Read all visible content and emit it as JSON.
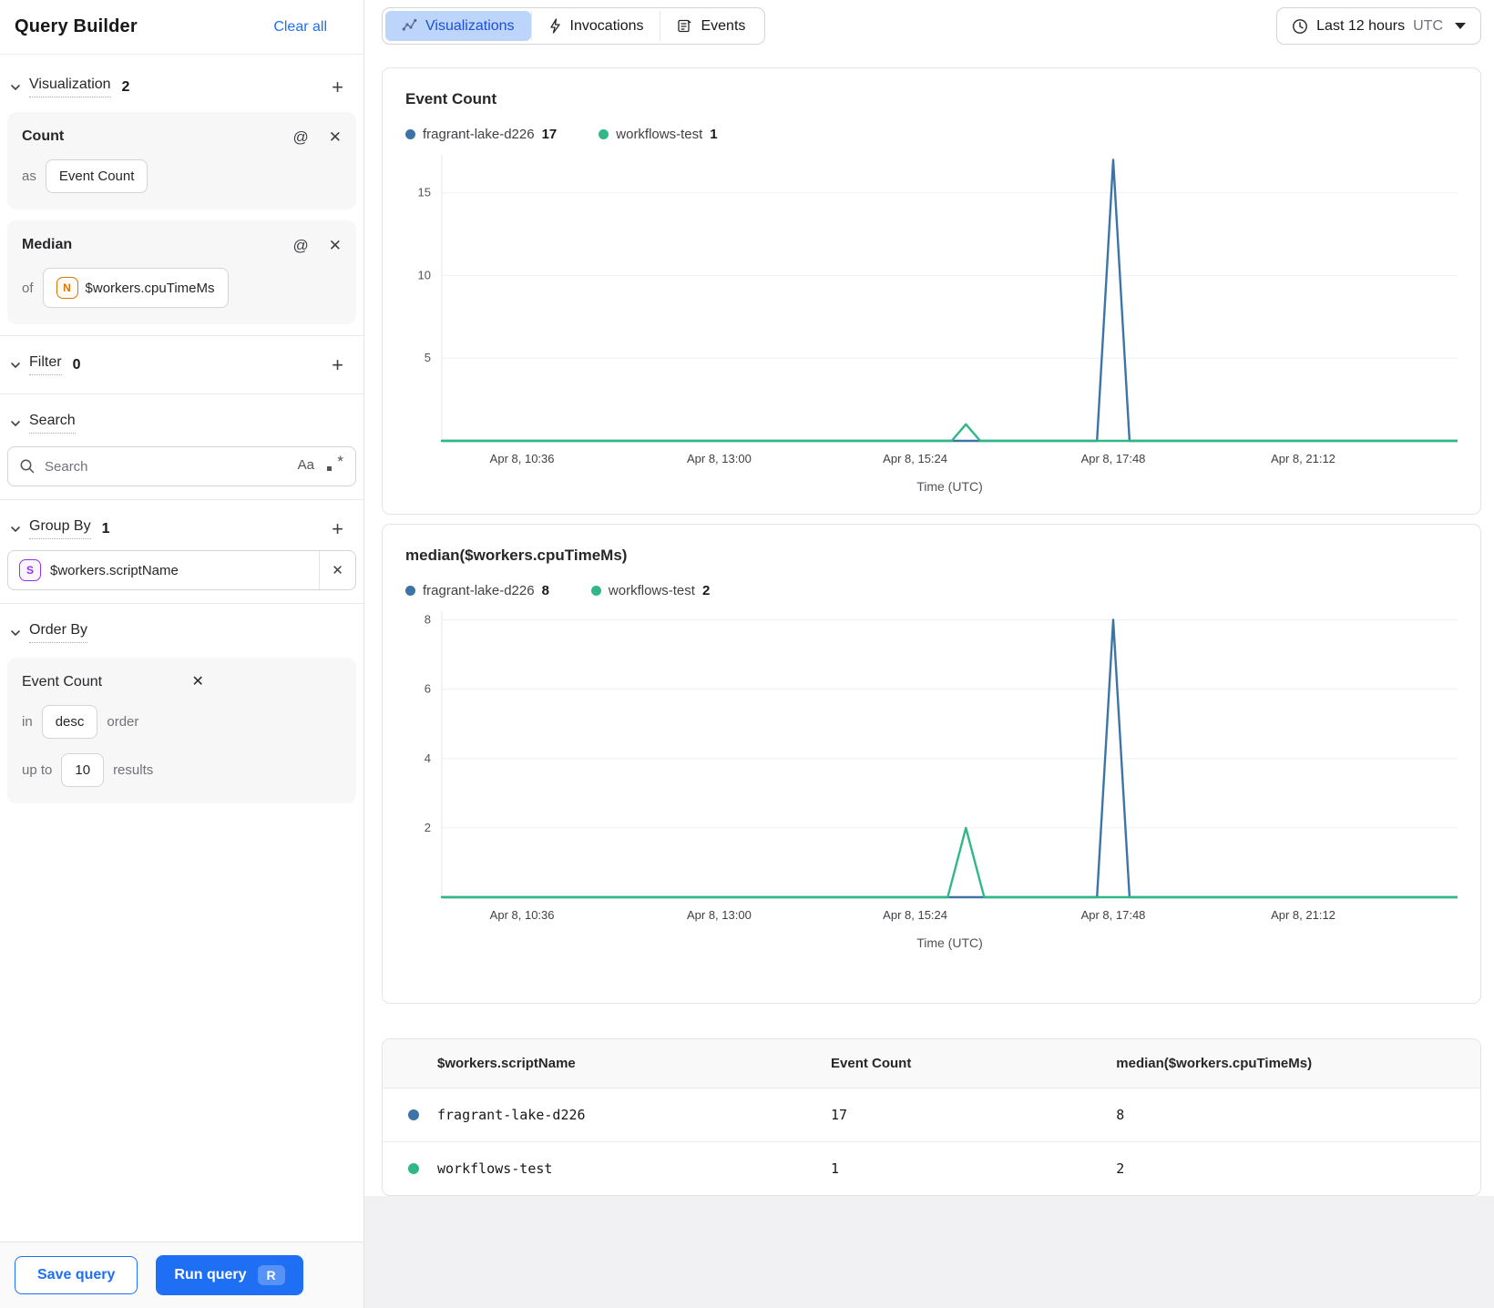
{
  "colors": {
    "accent_blue": "#1f6ff5",
    "active_tab_bg": "#bdd4fb",
    "active_tab_text": "#1d4ed8",
    "series_blue": "#3d74a8",
    "series_green": "#2fb885"
  },
  "sidebar": {
    "title": "Query Builder",
    "clear_all": "Clear all",
    "visualization": {
      "label": "Visualization",
      "count": "2",
      "cards": [
        {
          "title": "Count",
          "prefix": "as",
          "value": "Event Count"
        },
        {
          "title": "Median",
          "prefix": "of",
          "badge": "N",
          "value": "$workers.cpuTimeMs"
        }
      ]
    },
    "filter": {
      "label": "Filter",
      "count": "0"
    },
    "search": {
      "label": "Search",
      "placeholder": "Search",
      "match_case": "Aa"
    },
    "group_by": {
      "label": "Group By",
      "count": "1",
      "items": [
        {
          "badge": "S",
          "value": "$workers.scriptName"
        }
      ]
    },
    "order_by": {
      "label": "Order By",
      "field": "Event Count",
      "in_label": "in",
      "direction": "desc",
      "order_label": "order",
      "up_to_label": "up to",
      "limit": "10",
      "results_label": "results"
    },
    "footer": {
      "save": "Save query",
      "run": "Run query",
      "shortcut": "R"
    }
  },
  "topbar": {
    "tabs": [
      {
        "label": "Visualizations",
        "icon": "trend-icon",
        "active": true
      },
      {
        "label": "Invocations",
        "icon": "lightning-icon",
        "active": false
      },
      {
        "label": "Events",
        "icon": "events-icon",
        "active": false
      }
    ],
    "time_range": {
      "label": "Last 12 hours",
      "timezone": "UTC"
    }
  },
  "chart_data": [
    {
      "type": "line",
      "title": "Event Count",
      "xlabel": "Time (UTC)",
      "x_ticks": [
        "Apr 8, 10:36",
        "Apr 8, 13:00",
        "Apr 8, 15:24",
        "Apr 8, 17:48",
        "Apr 8, 21:12"
      ],
      "x_tick_fractions": [
        0.079,
        0.273,
        0.466,
        0.661,
        0.848
      ],
      "y_ticks": [
        5,
        10,
        15
      ],
      "ylim": [
        0,
        17.3
      ],
      "grid": true,
      "legend_position": "top",
      "legend": [
        {
          "name": "fragrant-lake-d226",
          "value": "17",
          "color": "#3d74a8"
        },
        {
          "name": "workflows-test",
          "value": "1",
          "color": "#2fb885"
        }
      ],
      "series": [
        {
          "name": "fragrant-lake-d226",
          "color": "#3d74a8",
          "points": [
            [
              0,
              0
            ],
            [
              0.645,
              0
            ],
            [
              0.661,
              17
            ],
            [
              0.677,
              0
            ],
            [
              1,
              0
            ]
          ]
        },
        {
          "name": "workflows-test",
          "color": "#2fb885",
          "points": [
            [
              0,
              0
            ],
            [
              0.502,
              0
            ],
            [
              0.516,
              1
            ],
            [
              0.53,
              0
            ],
            [
              1,
              0
            ]
          ]
        }
      ]
    },
    {
      "type": "line",
      "title": "median($workers.cpuTimeMs)",
      "xlabel": "Time (UTC)",
      "x_ticks": [
        "Apr 8, 10:36",
        "Apr 8, 13:00",
        "Apr 8, 15:24",
        "Apr 8, 17:48",
        "Apr 8, 21:12"
      ],
      "x_tick_fractions": [
        0.079,
        0.273,
        0.466,
        0.661,
        0.848
      ],
      "y_ticks": [
        2,
        4,
        6,
        8
      ],
      "ylim": [
        0,
        8.25
      ],
      "grid": true,
      "legend_position": "top",
      "legend": [
        {
          "name": "fragrant-lake-d226",
          "value": "8",
          "color": "#3d74a8"
        },
        {
          "name": "workflows-test",
          "value": "2",
          "color": "#2fb885"
        }
      ],
      "series": [
        {
          "name": "fragrant-lake-d226",
          "color": "#3d74a8",
          "points": [
            [
              0,
              0
            ],
            [
              0.645,
              0
            ],
            [
              0.661,
              8
            ],
            [
              0.677,
              0
            ],
            [
              1,
              0
            ]
          ]
        },
        {
          "name": "workflows-test",
          "color": "#2fb885",
          "points": [
            [
              0,
              0
            ],
            [
              0.498,
              0
            ],
            [
              0.516,
              2
            ],
            [
              0.534,
              0
            ],
            [
              1,
              0
            ]
          ]
        }
      ]
    }
  ],
  "table": {
    "headers": [
      "$workers.scriptName",
      "Event Count",
      "median($workers.cpuTimeMs)"
    ],
    "rows": [
      {
        "color": "#3d74a8",
        "cells": [
          "fragrant-lake-d226",
          "17",
          "8"
        ]
      },
      {
        "color": "#2fb885",
        "cells": [
          "workflows-test",
          "1",
          "2"
        ]
      }
    ]
  }
}
